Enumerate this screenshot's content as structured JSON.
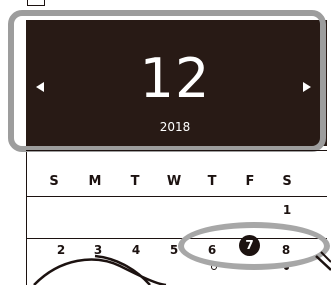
{
  "calendar": {
    "month": "12",
    "year": "2018",
    "weekdays": [
      "S",
      "M",
      "T",
      "W",
      "T",
      "F",
      "S"
    ],
    "week1": [
      "1"
    ],
    "week2": [
      "2",
      "3",
      "4",
      "5",
      "6",
      "7",
      "8"
    ],
    "selected_day": "7",
    "nav": {
      "prev_icon": "triangle-left-icon",
      "next_icon": "triangle-right-icon"
    }
  },
  "colors": {
    "header_bg": "#281a15",
    "text": "#1c1210",
    "highlight_gray": "#a7a7a7"
  }
}
